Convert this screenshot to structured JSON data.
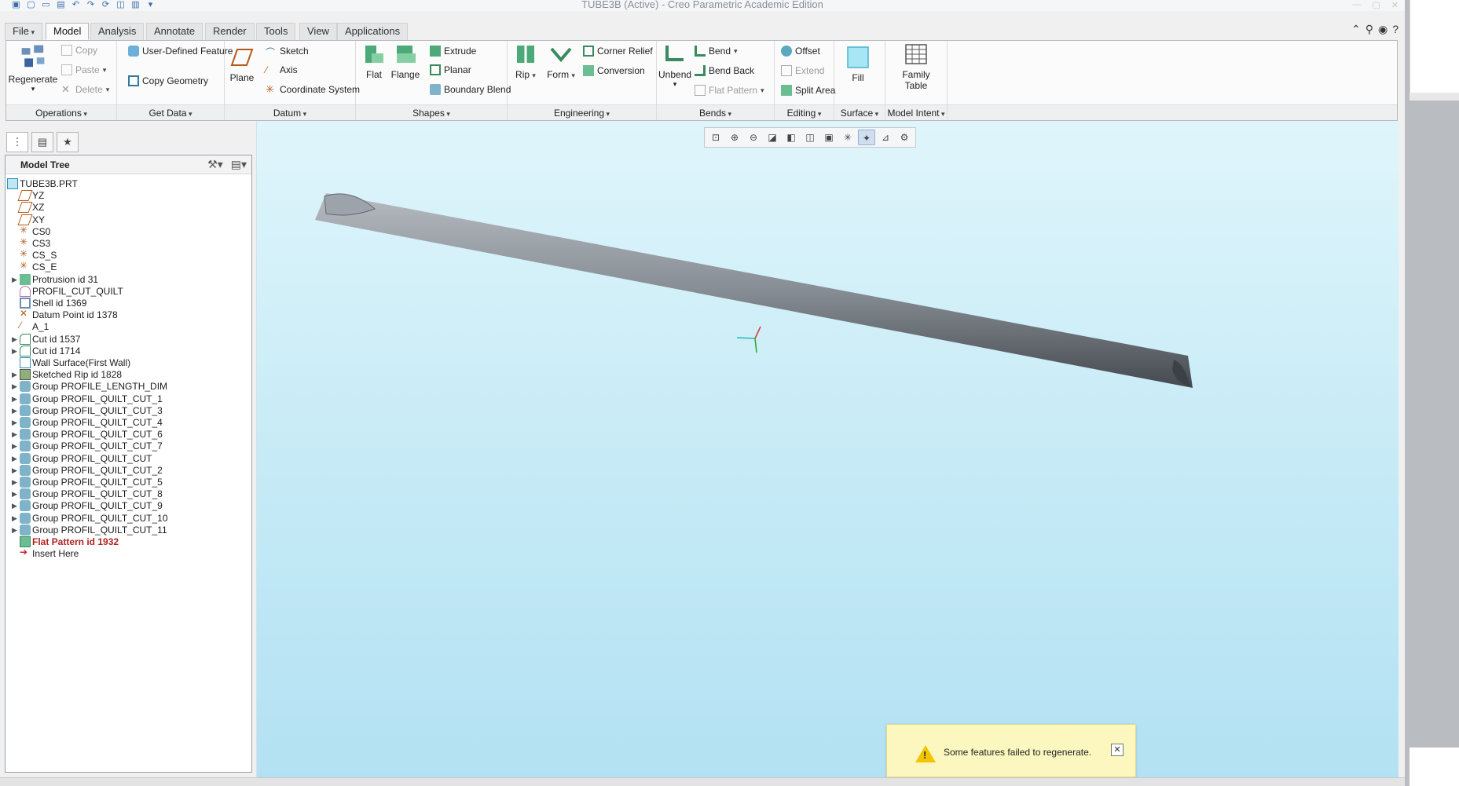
{
  "window": {
    "title": "TUBE3B (Active) - Creo Parametric Academic Edition"
  },
  "tabs": [
    {
      "label": "File",
      "state": "file"
    },
    {
      "label": "Model",
      "state": "active"
    },
    {
      "label": "Analysis",
      "state": "inactive"
    },
    {
      "label": "Annotate",
      "state": "inactive"
    },
    {
      "label": "Render",
      "state": "inactive"
    },
    {
      "label": "Tools",
      "state": "inactive"
    },
    {
      "label": "View",
      "state": "inactive"
    },
    {
      "label": "Applications",
      "state": "inactive"
    }
  ],
  "ribbon": {
    "operations": {
      "footer": "Operations",
      "regenerate": "Regenerate",
      "copy": "Copy",
      "paste": "Paste",
      "delete": "Delete"
    },
    "get_data": {
      "footer": "Get Data",
      "udf": "User-Defined Feature",
      "copy_geometry": "Copy Geometry"
    },
    "datum": {
      "footer": "Datum",
      "plane": "Plane",
      "sketch": "Sketch",
      "axis": "Axis",
      "coord_sys": "Coordinate System"
    },
    "shapes": {
      "footer": "Shapes",
      "flat": "Flat",
      "flange": "Flange",
      "extrude": "Extrude",
      "planar": "Planar",
      "boundary_blend": "Boundary Blend"
    },
    "engineering": {
      "footer": "Engineering",
      "rip": "Rip",
      "form": "Form",
      "corner_relief": "Corner Relief",
      "conversion": "Conversion"
    },
    "bends": {
      "footer": "Bends",
      "unbend": "Unbend",
      "bend": "Bend",
      "bend_back": "Bend Back",
      "flat_pattern": "Flat Pattern"
    },
    "editing": {
      "footer": "Editing",
      "offset": "Offset",
      "extend": "Extend",
      "split_area": "Split Area"
    },
    "surface": {
      "footer": "Surface",
      "fill": "Fill"
    },
    "model_intent": {
      "footer": "Model Intent",
      "family_table_1": "Family",
      "family_table_2": "Table"
    }
  },
  "tree": {
    "header": "Model Tree",
    "items": [
      {
        "label": "TUBE3B.PRT",
        "icon": "part-icon",
        "expand": false,
        "indent": 0
      },
      {
        "label": "YZ",
        "icon": "datum-plane-icon",
        "expand": false,
        "indent": 1
      },
      {
        "label": "XZ",
        "icon": "datum-plane-icon",
        "expand": false,
        "indent": 1
      },
      {
        "label": "XY",
        "icon": "datum-plane-icon",
        "expand": false,
        "indent": 1
      },
      {
        "label": "CS0",
        "icon": "coordinate-system-icon",
        "expand": false,
        "indent": 1
      },
      {
        "label": "CS3",
        "icon": "coordinate-system-icon",
        "expand": false,
        "indent": 1
      },
      {
        "label": "CS_S",
        "icon": "coordinate-system-icon",
        "expand": false,
        "indent": 1
      },
      {
        "label": "CS_E",
        "icon": "coordinate-system-icon",
        "expand": false,
        "indent": 1
      },
      {
        "label": "Protrusion id 31",
        "icon": "protrusion-icon",
        "expand": true,
        "indent": 1
      },
      {
        "label": "PROFIL_CUT_QUILT",
        "icon": "quilt-icon",
        "expand": false,
        "indent": 1
      },
      {
        "label": "Shell id 1369",
        "icon": "shell-icon",
        "expand": false,
        "indent": 1
      },
      {
        "label": "Datum Point id 1378",
        "icon": "datum-point-icon",
        "expand": false,
        "indent": 1
      },
      {
        "label": "A_1",
        "icon": "datum-axis-icon",
        "expand": false,
        "indent": 1
      },
      {
        "label": "Cut id 1537",
        "icon": "cut-icon",
        "expand": true,
        "indent": 1
      },
      {
        "label": "Cut id 1714",
        "icon": "cut-icon",
        "expand": true,
        "indent": 1
      },
      {
        "label": "Wall Surface(First Wall)",
        "icon": "wall-surface-icon",
        "expand": false,
        "indent": 1
      },
      {
        "label": "Sketched Rip id 1828",
        "icon": "sketched-rip-icon",
        "expand": true,
        "indent": 1
      },
      {
        "label": "Group PROFILE_LENGTH_DIM",
        "icon": "group-icon",
        "expand": true,
        "indent": 1
      },
      {
        "label": "Group PROFIL_QUILT_CUT_1",
        "icon": "group-icon",
        "expand": true,
        "indent": 1
      },
      {
        "label": "Group PROFIL_QUILT_CUT_3",
        "icon": "group-icon",
        "expand": true,
        "indent": 1
      },
      {
        "label": "Group PROFIL_QUILT_CUT_4",
        "icon": "group-icon",
        "expand": true,
        "indent": 1
      },
      {
        "label": "Group PROFIL_QUILT_CUT_6",
        "icon": "group-icon",
        "expand": true,
        "indent": 1
      },
      {
        "label": "Group PROFIL_QUILT_CUT_7",
        "icon": "group-icon",
        "expand": true,
        "indent": 1
      },
      {
        "label": "Group PROFIL_QUILT_CUT",
        "icon": "group-icon",
        "expand": true,
        "indent": 1
      },
      {
        "label": "Group PROFIL_QUILT_CUT_2",
        "icon": "group-icon",
        "expand": true,
        "indent": 1
      },
      {
        "label": "Group PROFIL_QUILT_CUT_5",
        "icon": "group-icon",
        "expand": true,
        "indent": 1
      },
      {
        "label": "Group PROFIL_QUILT_CUT_8",
        "icon": "group-icon",
        "expand": true,
        "indent": 1
      },
      {
        "label": "Group PROFIL_QUILT_CUT_9",
        "icon": "group-icon",
        "expand": true,
        "indent": 1
      },
      {
        "label": "Group PROFIL_QUILT_CUT_10",
        "icon": "group-icon",
        "expand": true,
        "indent": 1
      },
      {
        "label": "Group PROFIL_QUILT_CUT_11",
        "icon": "group-icon",
        "expand": true,
        "indent": 1
      },
      {
        "label": "Flat Pattern id 1932",
        "icon": "flat-pattern-icon",
        "expand": false,
        "indent": 1,
        "error": true
      },
      {
        "label": "Insert Here",
        "icon": "insert-here-icon",
        "expand": false,
        "indent": 1
      }
    ]
  },
  "notification": {
    "message": "Some features failed to regenerate."
  },
  "colors": {
    "accent": "#3a6da8",
    "error_text": "#b02222",
    "viewport_top": "#dff5fb",
    "viewport_bottom": "#b3e1f3",
    "notify_bg": "#fbf7bf",
    "warning": "#f2c500"
  }
}
